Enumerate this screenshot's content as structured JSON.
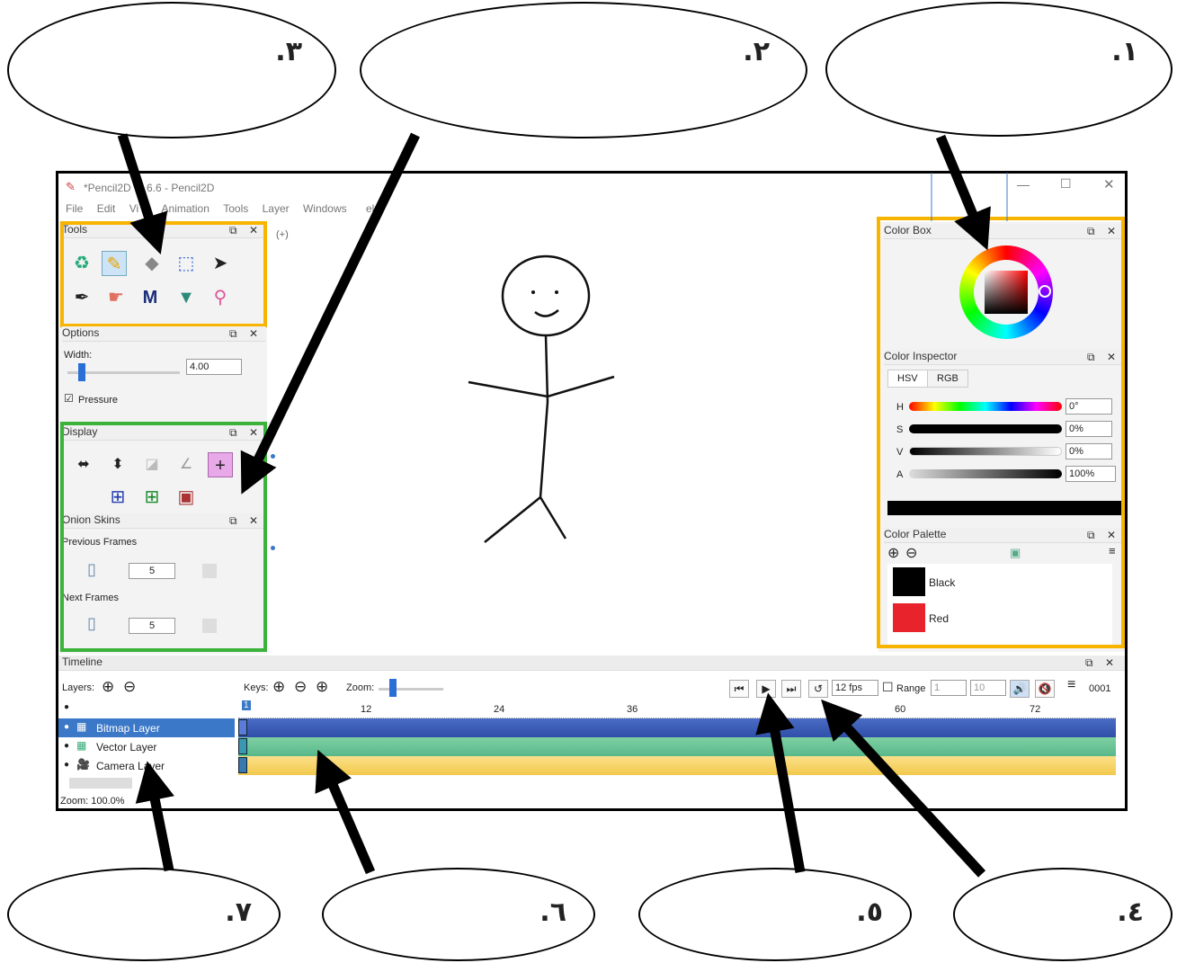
{
  "bubbles": [
    {
      "label": ".١"
    },
    {
      "label": ".٢"
    },
    {
      "label": ".٣"
    },
    {
      "label": ".٤"
    },
    {
      "label": ".٥"
    },
    {
      "label": ".٦"
    },
    {
      "label": ".٧"
    }
  ],
  "window": {
    "title": "*Pencil2D",
    "title_tail": "6.6 - Pencil2D",
    "menu": [
      "File",
      "Edit",
      "Vi",
      "Animation",
      "Tools",
      "Layer",
      "Windows",
      "elp"
    ]
  },
  "tools_panel": {
    "title": "Tools"
  },
  "options_panel": {
    "title": "Options",
    "width_label": "Width:",
    "width_value": "4.00",
    "pressure_label": "Pressure"
  },
  "display_panel": {
    "title": "Display"
  },
  "onion_panel": {
    "title": "Onion Skins",
    "prev_label": "Previous Frames",
    "next_label": "Next Frames",
    "prev_value": "5",
    "next_value": "5"
  },
  "color_box": {
    "title": "Color Box"
  },
  "color_inspector": {
    "title": "Color Inspector",
    "tabs": [
      "HSV",
      "RGB"
    ],
    "rows": [
      {
        "label": "H",
        "value": "0°"
      },
      {
        "label": "S",
        "value": "0%"
      },
      {
        "label": "V",
        "value": "0%"
      },
      {
        "label": "A",
        "value": "100%"
      }
    ]
  },
  "color_palette": {
    "title": "Color Palette",
    "swatches": [
      {
        "name": "Black",
        "color": "#000000"
      },
      {
        "name": "Red",
        "color": "#e8232b"
      }
    ]
  },
  "timeline": {
    "title": "Timeline",
    "layers_label": "Layers:",
    "keys_label": "Keys:",
    "zoom_label": "Zoom:",
    "fps": "12 fps",
    "range_label": "Range",
    "range_start": "1",
    "range_end": "10",
    "frame_counter": "0001",
    "ruler": [
      "1",
      "12",
      "24",
      "36",
      "60",
      "72"
    ],
    "layers": [
      {
        "name": "Bitmap Layer",
        "color": "#2f4fa8"
      },
      {
        "name": "Vector Layer",
        "color": "#57b88a"
      },
      {
        "name": "Camera Layer",
        "color": "#f2c94c"
      }
    ],
    "status": "Zoom: 100.0%"
  },
  "colors": {
    "highlight_yellow": "#f7b400",
    "highlight_green": "#3bb33b",
    "selection_blue": "#3c78c8"
  }
}
